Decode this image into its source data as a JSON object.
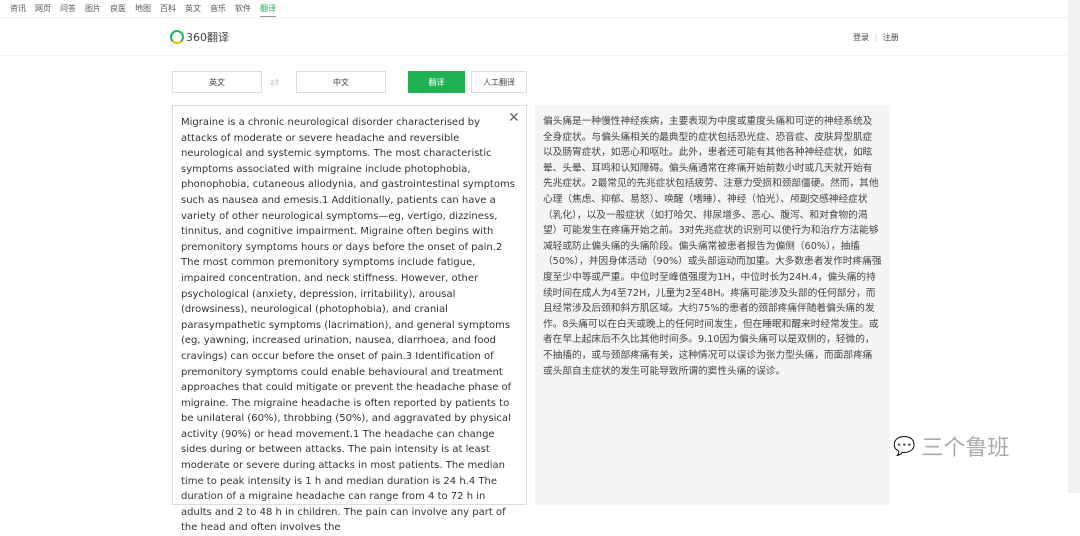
{
  "nav": [
    "资讯",
    "网页",
    "问答",
    "图片",
    "良医",
    "地图",
    "百科",
    "英文",
    "音乐",
    "软件",
    "翻译"
  ],
  "logo": "360翻译",
  "auth": {
    "login": "登录",
    "sep": "|",
    "register": "注册"
  },
  "controls": {
    "source_lang": "英文",
    "target_lang": "中文",
    "swap": "⇄",
    "translate": "翻译",
    "human": "人工翻译"
  },
  "source_text": "Migraine is a chronic neurological disorder characterised by attacks of moderate or severe headache and reversible neurological and systemic symptoms. The most characteristic symptoms associated with migraine include photophobia, phonophobia, cutaneous allodynia, and gastrointestinal symptoms such as nausea and emesis.1 Additionally, patients can have a variety of other neurological symptoms—eg, vertigo, dizziness, tinnitus, and cognitive impairment. Migraine often begins with premonitory symptoms hours or days before the onset of pain.2 The most common premonitory symptoms include fatigue, impaired concentration, and neck stiffness. However, other psychological (anxiety, depression, irritability), arousal (drowsiness), neurological (photophobia), and cranial parasympathetic symptoms (lacrimation), and general symptoms (eg, yawning, increased urination, nausea, diarrhoea, and food cravings) can occur before the onset of pain.3 Identification of premonitory symptoms could enable behavioural and treatment approaches that could mitigate or prevent the headache phase of migraine. The migraine headache is often reported by patients to be unilateral (60%), throbbing (50%), and aggravated by physical activity (90%) or head movement.1 The headache can change sides during or between attacks. The pain intensity is at least moderate or severe during attacks in most patients. The median time to peak intensity is 1 h and median duration is 24 h.4 The duration of a migraine headache can range from 4 to 72 h in adults and 2 to 48 h in children. The pain can involve any part of the head and often involves the",
  "close": "✕",
  "target_text": "偏头痛是一种慢性神经疾病，主要表现为中度或重度头痛和可逆的神经系统及全身症状。与偏头痛相关的最典型的症状包括恐光症、恐音症、皮肤异型肌症以及肠胃症状，如恶心和呕吐。此外，患者还可能有其他各种神经症状，如眩晕、头晕、耳鸣和认知障碍。偏头痛通常在疼痛开始前数小时或几天就开始有先兆症状。2最常见的先兆症状包括疲劳、注意力受损和颈部僵硬。然而，其他心理（焦虑、抑郁、易怒）、唤醒（嗜睡）、神经（怕光）、颅副交感神经症状（乳化），以及一般症状（如打哈欠、排尿增多、恶心、腹泻、和对食物的渴望）可能发生在疼痛开始之前。3对先兆症状的识别可以使行为和治疗方法能够减轻或防止偏头痛的头痛阶段。偏头痛常被患者报告为偏侧（60%），抽搐（50%），并因身体活动（90%）或头部运动而加重。大多数患者发作时疼痛强度至少中等或严重。中位时至峰值强度为1H，中位时长为24H.4，偏头痛的持续时间在成人为4至72H，儿童为2至48H。疼痛可能涉及头部的任何部分，而且经常涉及后颈和斜方肌区域。大约75%的患者的颈部疼痛伴随着偏头痛的发作。8头痛可以在白天或晚上的任何时间发生，但在睡眠和醒来时经常发生。或者在早上起床后不久比其他时间多。9.10因为偏头痛可以是双侧的，轻微的，不抽搐的，或与颈部疼痛有关，这种情况可以误诊为张力型头痛，而面部疼痛或头部自主症状的发生可能导致所谓的窦性头痛的误诊。",
  "watermark": "三个鲁班"
}
